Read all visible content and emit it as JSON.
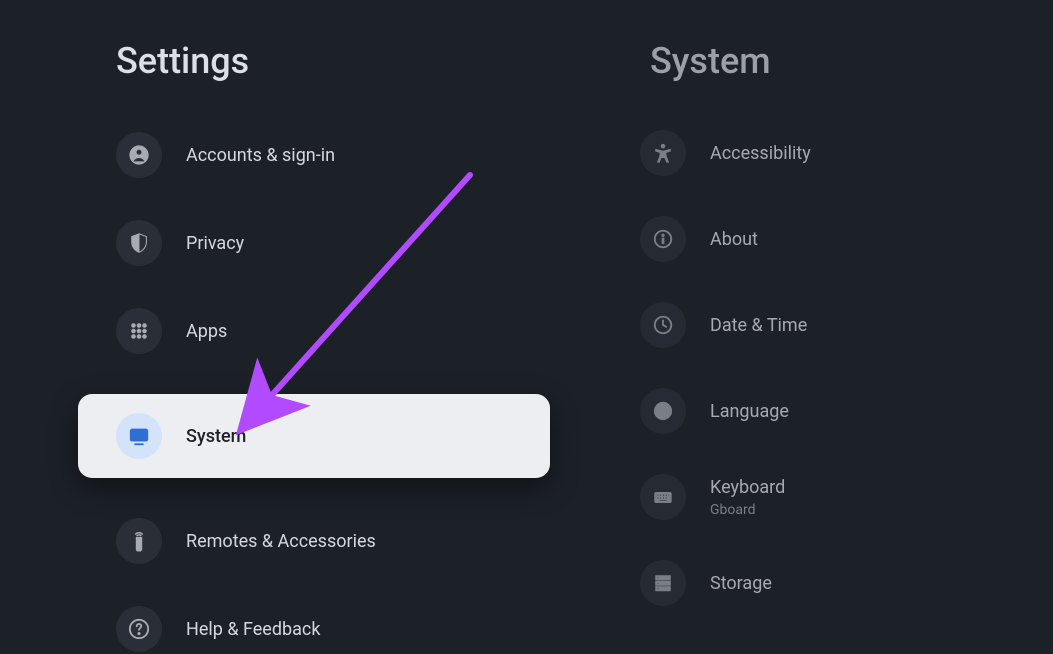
{
  "left": {
    "title": "Settings",
    "items": [
      {
        "icon": "account",
        "label": "Accounts & sign-in",
        "selected": false
      },
      {
        "icon": "privacy",
        "label": "Privacy",
        "selected": false
      },
      {
        "icon": "apps",
        "label": "Apps",
        "selected": false
      },
      {
        "icon": "system",
        "label": "System",
        "selected": true
      },
      {
        "icon": "remotes",
        "label": "Remotes & Accessories",
        "selected": false
      },
      {
        "icon": "help",
        "label": "Help & Feedback",
        "selected": false
      }
    ]
  },
  "right": {
    "title": "System",
    "items": [
      {
        "icon": "accessibility",
        "label": "Accessibility",
        "sublabel": ""
      },
      {
        "icon": "about",
        "label": "About",
        "sublabel": ""
      },
      {
        "icon": "time",
        "label": "Date & Time",
        "sublabel": ""
      },
      {
        "icon": "language",
        "label": "Language",
        "sublabel": ""
      },
      {
        "icon": "keyboard",
        "label": "Keyboard",
        "sublabel": "Gboard"
      },
      {
        "icon": "storage",
        "label": "Storage",
        "sublabel": ""
      }
    ]
  },
  "annotation": {
    "arrow_color": "#b24bff"
  }
}
